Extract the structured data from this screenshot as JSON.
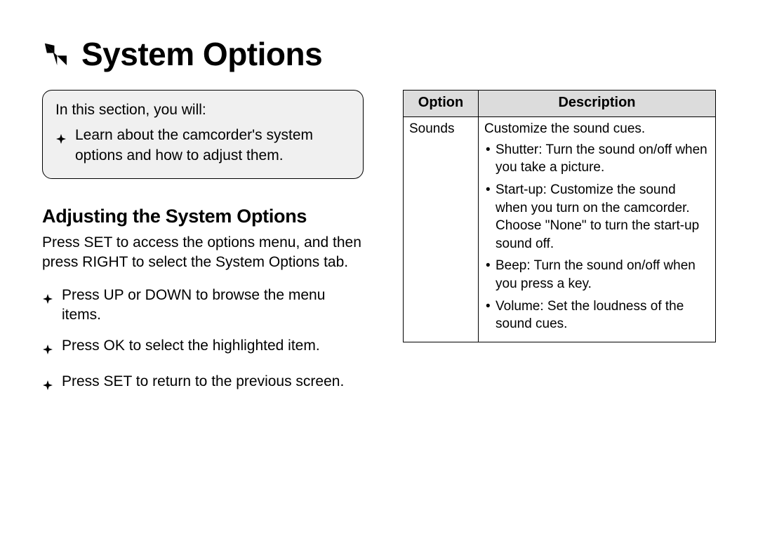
{
  "title": "System Options",
  "callout": {
    "lead": "In this section, you will:",
    "item": "Learn about the camcorder's system options and how to adjust them."
  },
  "section_heading": "Adjusting the System Options",
  "intro": "Press SET to access the options menu, and then press RIGHT to select the System Options tab.",
  "instructions": [
    "Press UP or DOWN to browse the menu items.",
    "Press OK to select the highlighted item.",
    "Press SET to return to the previous screen."
  ],
  "table": {
    "headers": {
      "option": "Option",
      "description": "Description"
    },
    "row": {
      "option": "Sounds",
      "lead": "Customize the sound cues.",
      "bullets": [
        "Shutter: Turn the sound on/off when you take a picture.",
        "Start-up: Customize the sound when you turn on the camcorder. Choose \"None\" to turn the start-up sound off.",
        "Beep: Turn the sound on/off when you press a key.",
        "Volume: Set the loudness of the sound cues."
      ]
    }
  }
}
